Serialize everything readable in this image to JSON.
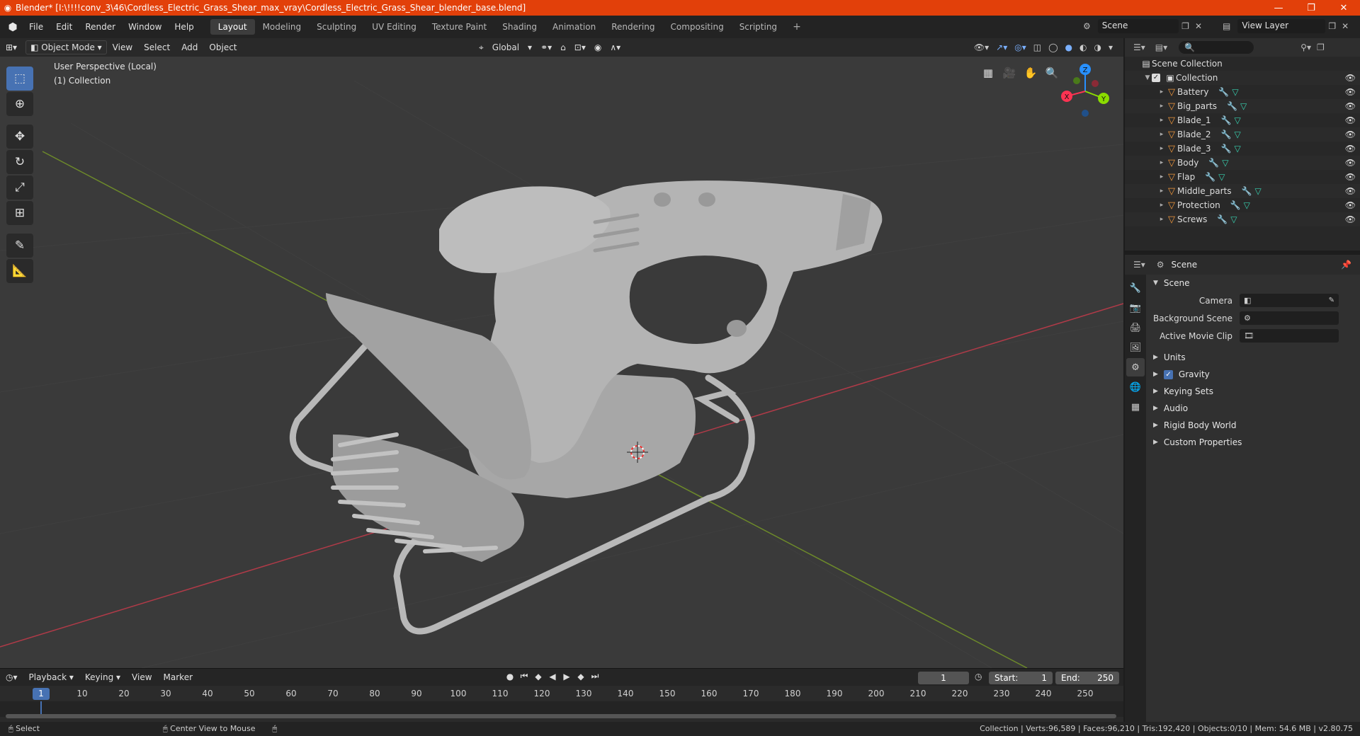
{
  "window": {
    "title": "Blender* [I:\\!!!!conv_3\\46\\Cordless_Electric_Grass_Shear_max_vray\\Cordless_Electric_Grass_Shear_blender_base.blend]",
    "minimize": "—",
    "maximize": "❐",
    "close": "✕"
  },
  "menu": [
    "File",
    "Edit",
    "Render",
    "Window",
    "Help"
  ],
  "workspaces": [
    "Layout",
    "Modeling",
    "Sculpting",
    "UV Editing",
    "Texture Paint",
    "Shading",
    "Animation",
    "Rendering",
    "Compositing",
    "Scripting"
  ],
  "scene_name": "Scene",
  "view_layer": "View Layer",
  "viewport": {
    "mode": "Object Mode",
    "menus": [
      "View",
      "Select",
      "Add",
      "Object"
    ],
    "transform_orientation": "Global",
    "info_line1": "User Perspective (Local)",
    "info_line2": "(1) Collection",
    "gizmo": {
      "x": "X",
      "y": "Y",
      "z": "Z"
    }
  },
  "timeline": {
    "menus": [
      "Playback",
      "Keying",
      "View",
      "Marker"
    ],
    "current_frame": "1",
    "start_label": "Start:",
    "start": "1",
    "end_label": "End:",
    "end": "250",
    "ticks": [
      "10",
      "20",
      "30",
      "40",
      "50",
      "60",
      "70",
      "80",
      "90",
      "100",
      "110",
      "120",
      "130",
      "140",
      "150",
      "160",
      "170",
      "180",
      "190",
      "200",
      "210",
      "220",
      "230",
      "240",
      "250"
    ]
  },
  "statusbar": {
    "select": "Select",
    "center_view": "Center View to Mouse",
    "stats": "Collection | Verts:96,589 | Faces:96,210 | Tris:192,420 | Objects:0/10 | Mem: 54.6 MB | v2.80.75"
  },
  "outliner": {
    "root": "Scene Collection",
    "collection": "Collection",
    "objects": [
      "Battery",
      "Big_parts",
      "Blade_1",
      "Blade_2",
      "Blade_3",
      "Body",
      "Flap",
      "Middle_parts",
      "Protection",
      "Screws"
    ]
  },
  "properties": {
    "header": "Scene",
    "panel": "Scene",
    "camera_label": "Camera",
    "background_label": "Background Scene",
    "movieclip_label": "Active Movie Clip",
    "sections": [
      "Units",
      "Gravity",
      "Keying Sets",
      "Audio",
      "Rigid Body World",
      "Custom Properties"
    ]
  },
  "colors": {
    "titlebar": "#e2400a",
    "accent": "#4772b3",
    "axis_x": "#ff3352",
    "axis_y": "#8bdc00",
    "axis_z": "#2890ff"
  }
}
